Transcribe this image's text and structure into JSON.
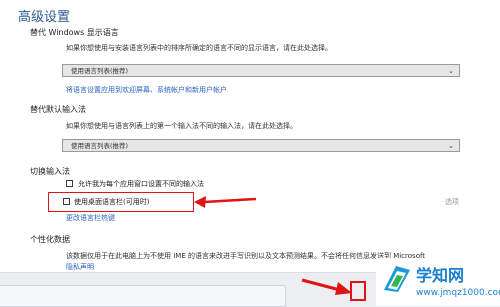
{
  "page_title": "高级设置",
  "display_lang": {
    "heading": "替代 Windows 显示语言",
    "description": "如果你想使用与安装语言列表中的排序所确定的语言不同的显示语言，请在此处选择。",
    "select_value": "使用语言列表(推荐)",
    "link": "将语言设置应用到欢迎屏幕、系统帐户和新用户帐户"
  },
  "input_method": {
    "heading": "替代默认输入法",
    "description": "如果你想使用与语言列表上的第一个输入法不同的输入法，请在此处选择。",
    "select_value": "使用语言列表(推荐)"
  },
  "switching": {
    "heading": "切换输入法",
    "option1": "允许我为每个应用窗口设置不同的输入法",
    "option2": "使用桌面语言栏(可用时)",
    "option2_side": "选项",
    "link": "更改语言栏热键"
  },
  "personalization": {
    "heading": "个性化数据",
    "description": "该数据仅用于在此电脑上为不使用 IME 的语言来改进手写识别以及文本预测结果。不会将任何信息发送到 Microsoft",
    "link": "隐私声明"
  },
  "watermark": {
    "name": "学知网",
    "url": "www.jmqz1000.com"
  },
  "colors": {
    "title": "#2a5b96",
    "link": "#2b63c4",
    "annotation": "#e01414",
    "watermark": "#1a7fd0"
  }
}
